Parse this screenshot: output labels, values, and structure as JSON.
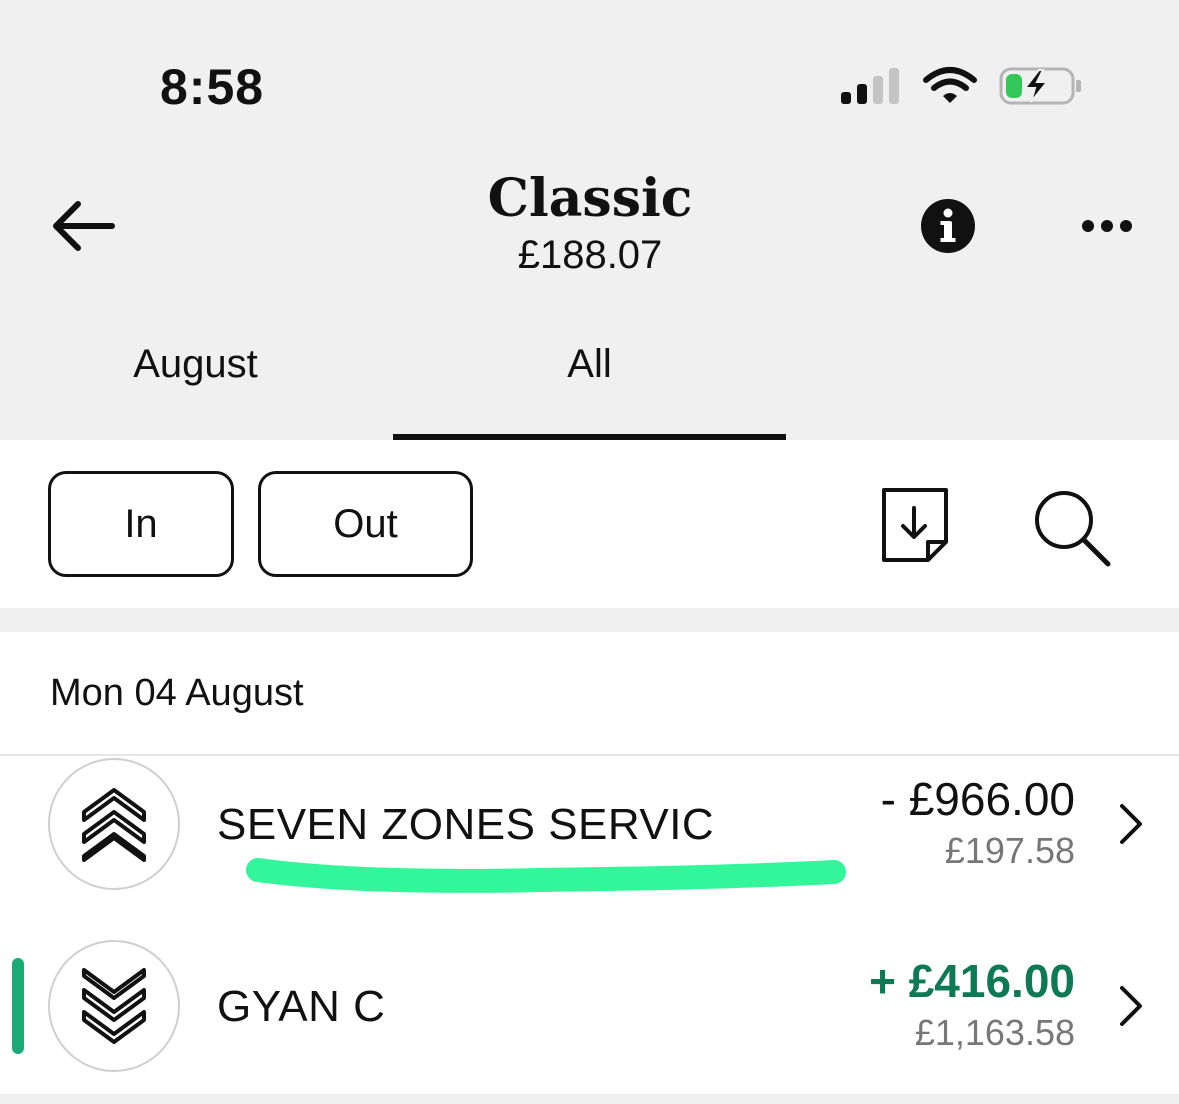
{
  "status_bar": {
    "time": "8:58",
    "icons": [
      "cellular-signal-icon",
      "wifi-icon",
      "battery-charging-icon"
    ],
    "battery_color": "#34c759"
  },
  "header": {
    "title": "Classic",
    "balance": "£188.07",
    "icons": [
      "back-arrow-icon",
      "info-icon",
      "more-icon"
    ]
  },
  "tabs": [
    {
      "label": "August",
      "selected": false
    },
    {
      "label": "All",
      "selected": true
    }
  ],
  "filters": {
    "in_label": "In",
    "out_label": "Out",
    "icons": [
      "download-statement-icon",
      "search-icon"
    ]
  },
  "transactions": {
    "date_header": "Mon 04 August",
    "items": [
      {
        "name": "SEVEN ZONES SERVIC",
        "amount": "- £966.00",
        "running_balance": "£197.58",
        "direction": "out",
        "icon": "chevrons-up-icon"
      },
      {
        "name": "GYAN C",
        "amount": "+ £416.00",
        "running_balance": "£1,163.58",
        "direction": "in",
        "icon": "chevrons-down-icon"
      }
    ]
  },
  "colors": {
    "credit": "#0e7a55",
    "credit_bar": "#1aaa78",
    "highlight": "#33f59a",
    "header_bg": "#f0f0f0"
  }
}
